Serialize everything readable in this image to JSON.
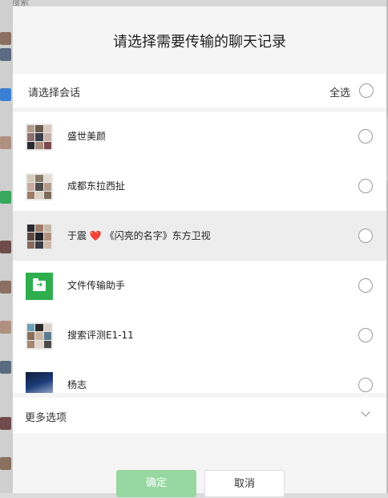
{
  "background": {
    "top_text": "搜索"
  },
  "dialog": {
    "title": "请选择需要传输的聊天记录",
    "section_label": "请选择会话",
    "select_all_label": "全选",
    "chats": [
      {
        "name": "盛世美颜",
        "avatar": "group-avatar",
        "highlighted": false
      },
      {
        "name": "成都东拉西扯",
        "avatar": "group-avatar",
        "highlighted": false
      },
      {
        "name_before": "于震 ",
        "emoji": "❤️",
        "name_after": " 《闪亮的名字》东方卫视",
        "avatar": "group-avatar",
        "highlighted": true
      },
      {
        "name": "文件传输助手",
        "avatar": "file-transfer-icon",
        "highlighted": false
      },
      {
        "name": "搜索评测E1-11",
        "avatar": "group-avatar",
        "highlighted": false
      },
      {
        "name": "杨志",
        "avatar": "photo-avatar",
        "highlighted": false
      }
    ],
    "more_options_label": "更多选项",
    "confirm_label": "确定",
    "cancel_label": "取消"
  },
  "colors": {
    "accent": "#2fae4e",
    "confirm_disabled": "#98d7a2",
    "heart": "#d22a2a"
  }
}
